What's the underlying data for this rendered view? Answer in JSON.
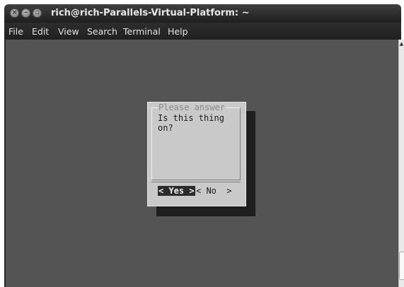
{
  "window": {
    "title": "rich@rich-Parallels-Virtual-Platform: ~",
    "controls": {
      "close_glyph": "×",
      "minimize_glyph": "–",
      "maximize_glyph": "▫"
    }
  },
  "menubar": {
    "items": [
      "File",
      "Edit",
      "View",
      "Search",
      "Terminal",
      "Help"
    ]
  },
  "dialog": {
    "title": "Please answer",
    "message": "Is this thing\non?",
    "buttons": {
      "yes": "< Yes >",
      "no": "< No  >"
    },
    "selected_button": "yes"
  },
  "scrollbar": {
    "up_glyph": "▲"
  },
  "colors": {
    "terminal_background": "#545454",
    "dialog_background": "#c9c9c9",
    "dialog_shadow": "#1e1e1e",
    "selected_button_background": "#2b2b2b"
  }
}
